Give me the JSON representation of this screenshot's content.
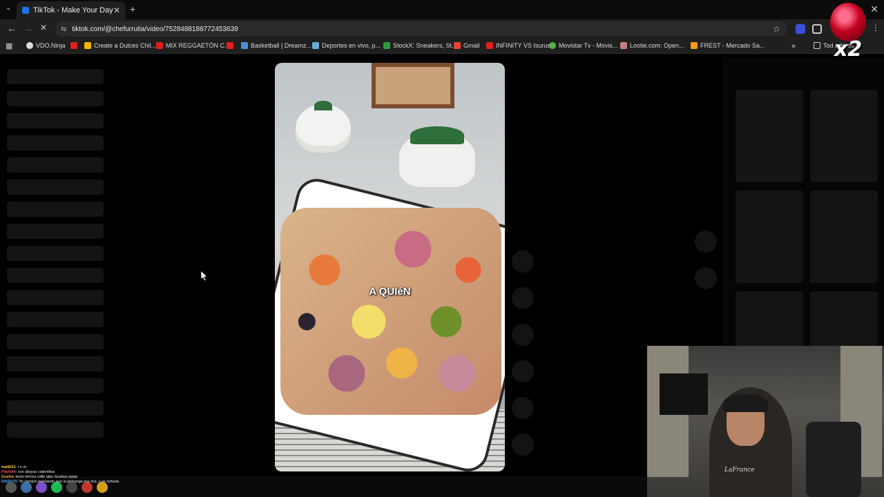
{
  "tab": {
    "title": "TikTok - Make Your Day",
    "close": "✕",
    "new_tab": "+",
    "menu": "⌄"
  },
  "toolbar": {
    "back": "←",
    "forward": "→",
    "reload": "✕",
    "site_info": "⇆",
    "url": "tiktok.com/@chefurrutia/video/7528488188772453639",
    "star": "☆"
  },
  "bookmarks": {
    "apps": "▦",
    "items": [
      {
        "label": "VDO.Ninja",
        "color": "#dddddd"
      },
      {
        "label": "",
        "color": "#e02020"
      },
      {
        "label": "Create a Dulces Chil...",
        "color": "#f4b400"
      },
      {
        "label": "MIX REGGAETÓN C...",
        "color": "#e02020"
      },
      {
        "label": "",
        "color": "#e02020"
      },
      {
        "label": "Basketball | Dreamz...",
        "color": "#4a90d9"
      },
      {
        "label": "Deportes en vivo, p...",
        "color": "#6aa9d8"
      },
      {
        "label": "StockX: Sneakers, St...",
        "color": "#2e9a3e"
      },
      {
        "label": "Gmail",
        "color": "#ea4335"
      },
      {
        "label": "INFINITY VS Isurus",
        "color": "#e02020"
      },
      {
        "label": "Movistar Tv - Movis...",
        "color": "#56b346"
      },
      {
        "label": "Lootie.com: Open...",
        "color": "#c08080"
      },
      {
        "label": "FREST - Mercado Sa...",
        "color": "#f39c12"
      }
    ],
    "overflow": "»",
    "all_folder": "Tod        adores"
  },
  "video": {
    "caption": "A QUIéN"
  },
  "overlay": {
    "badge": "x2",
    "shirt_text": "LaFrance"
  },
  "chat": [
    {
      "user": "matiti21",
      "user_color": "#ffd54a",
      "text": ": l e ric"
    },
    {
      "user": "Pitufofit",
      "user_color": "#ff4a6a",
      "text": ": con alluyas calientitas"
    },
    {
      "user": "Gustra",
      "user_color": "#ffb347",
      "text": ": tenis menos calle qlao lacabay jajaja"
    },
    {
      "user": "DNZKYS",
      "user_color": "#4aa3ff",
      "text": ": Yo compre pensando que la pichanga era rica, y es nefasta"
    }
  ],
  "colors": {
    "accent": "#1a73e8",
    "background": "#000000",
    "skeleton": "#141414"
  }
}
